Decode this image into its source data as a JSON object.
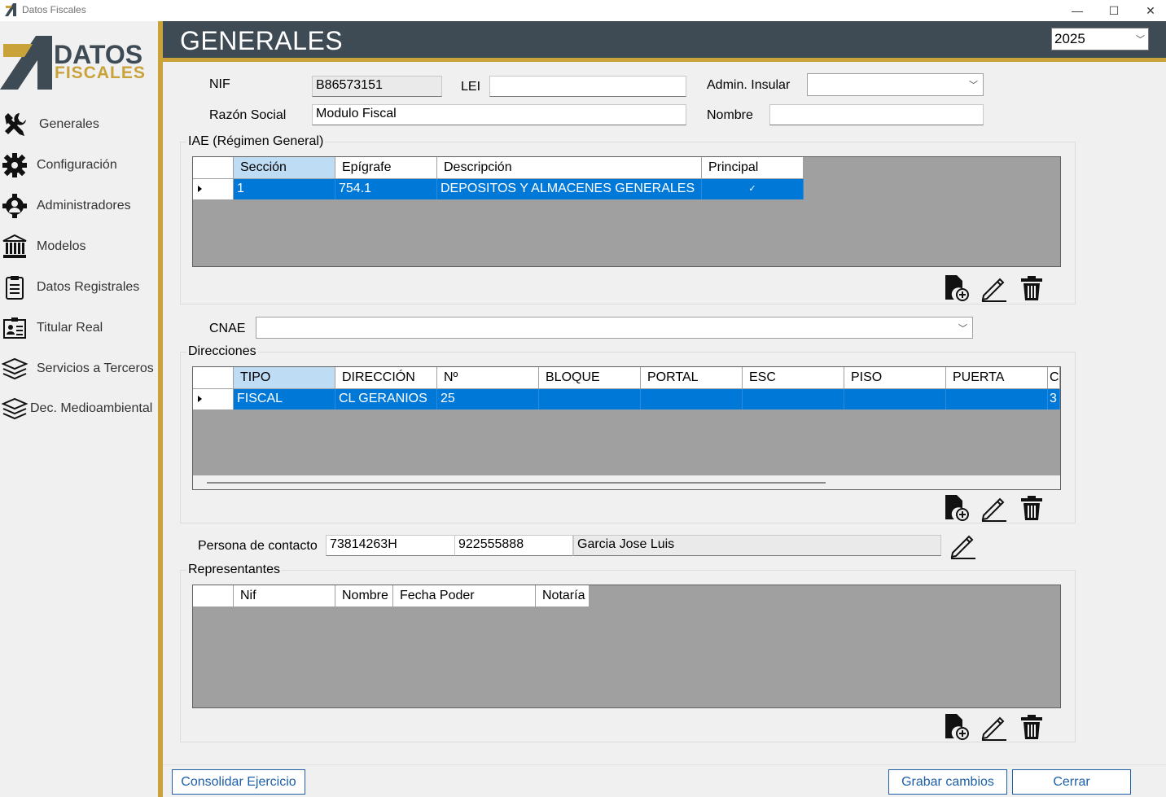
{
  "window": {
    "title": "Datos Fiscales",
    "minimize_glyph": "—",
    "maximize_glyph": "☐",
    "close_glyph": "✕"
  },
  "logo": {
    "line1": "DATOS",
    "line2": "FISCALES"
  },
  "sidebar": {
    "items": [
      {
        "label": "Generales",
        "icon": "tools-icon"
      },
      {
        "label": "Configuración",
        "icon": "gear-icon"
      },
      {
        "label": "Administradores",
        "icon": "admin-gear-icon"
      },
      {
        "label": "Modelos",
        "icon": "bank-icon"
      },
      {
        "label": "Datos Registrales",
        "icon": "clipboard-icon"
      },
      {
        "label": "Titular Real",
        "icon": "id-card-icon"
      },
      {
        "label": "Servicios a Terceros",
        "icon": "layers-icon"
      },
      {
        "label": "Dec. Medioambiental",
        "icon": "layers-icon"
      }
    ]
  },
  "header": {
    "title": "GENERALES",
    "year": "2025"
  },
  "form": {
    "nif_label": "NIF",
    "nif_value": "B86573151",
    "lei_label": "LEI",
    "lei_value": "",
    "admin_label": "Admin. Insular",
    "admin_value": "",
    "razon_label": "Razón Social",
    "razon_value": "Modulo Fiscal",
    "nombre_label": "Nombre",
    "nombre_value": "",
    "cnae_label": "CNAE",
    "cnae_value": ""
  },
  "iae": {
    "title": "IAE (Régimen General)",
    "columns": [
      "Sección",
      "Epígrafe",
      "Descripción",
      "Principal"
    ],
    "rows": [
      {
        "seccion": "1",
        "epigrafe": "754.1",
        "descripcion": "DEPOSITOS Y ALMACENES GENERALES",
        "principal": "✓"
      }
    ]
  },
  "direcciones": {
    "title": "Direcciones",
    "columns": [
      "TIPO",
      "DIRECCIÓN",
      "Nº",
      "BLOQUE",
      "PORTAL",
      "ESC",
      "PISO",
      "PUERTA",
      "C"
    ],
    "rows": [
      {
        "tipo": "FISCAL",
        "direccion": "CL GERANIOS",
        "numero": "25",
        "bloque": "",
        "portal": "",
        "esc": "",
        "piso": "",
        "puerta": "",
        "cp": "3"
      }
    ]
  },
  "contacto": {
    "label": "Persona de contacto",
    "nif": "73814263H",
    "telefono": "922555888",
    "nombre": "Garcia Jose Luis"
  },
  "representantes": {
    "title": "Representantes",
    "columns": [
      "Nif",
      "Nombre",
      "Fecha Poder",
      "Notaría"
    ]
  },
  "footer": {
    "consolidar": "Consolidar Ejercicio",
    "grabar": "Grabar cambios",
    "cerrar": "Cerrar"
  },
  "colors": {
    "header": "#3e4b55",
    "accent": "#c9a23a",
    "selection": "#0078d7",
    "button_text": "#1c5fa8"
  }
}
